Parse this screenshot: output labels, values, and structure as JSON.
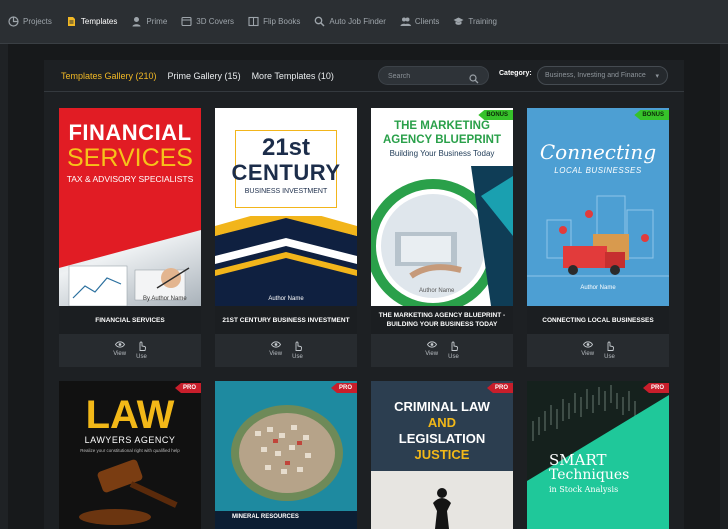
{
  "nav": {
    "items": [
      {
        "label": "Projects",
        "icon": "projects-icon",
        "active": false
      },
      {
        "label": "Templates",
        "icon": "templates-icon",
        "active": true
      },
      {
        "label": "Prime",
        "icon": "prime-icon",
        "active": false
      },
      {
        "label": "3D Covers",
        "icon": "3d-covers-icon",
        "active": false
      },
      {
        "label": "Flip Books",
        "icon": "flip-books-icon",
        "active": false
      },
      {
        "label": "Auto Job Finder",
        "icon": "search-icon",
        "active": false
      },
      {
        "label": "Clients",
        "icon": "clients-icon",
        "active": false
      },
      {
        "label": "Training",
        "icon": "training-icon",
        "active": false
      }
    ]
  },
  "gallery": {
    "tabs": [
      {
        "label": "Templates Gallery (210)",
        "active": true
      },
      {
        "label": "Prime Gallery (15)",
        "active": false
      },
      {
        "label": "More Templates (10)",
        "active": false
      }
    ],
    "search_placeholder": "Search",
    "category_label": "Category:",
    "category_value": "Business, Investing and Finance",
    "view_label": "View",
    "use_label": "Use"
  },
  "colors": {
    "accent": "#f1b825",
    "bonus": "#36c22a",
    "pro": "#c81e2b"
  },
  "cards": [
    {
      "title": "FINANCIAL SERVICES",
      "badge": "",
      "cover": {
        "line1": "FINANCIAL",
        "line2": "SERVICES",
        "line3": "TAX & ADVISORY SPECIALISTS",
        "author": "By Author Name"
      }
    },
    {
      "title": "21ST CENTURY BUSINESS INVESTMENT",
      "badge": "",
      "cover": {
        "line1": "21st",
        "line2": "CENTURY",
        "line3": "BUSINESS INVESTMENT",
        "author": "Author Name"
      }
    },
    {
      "title": "THE MARKETING AGENCY BLUEPRINT - BUILDING YOUR BUSINESS TODAY",
      "badge": "BONUS",
      "cover": {
        "line1": "THE MARKETING",
        "line2": "AGENCY BLUEPRINT",
        "line3": "Building Your Business Today",
        "author": "Author Name"
      }
    },
    {
      "title": "CONNECTING LOCAL BUSINESSES",
      "badge": "BONUS",
      "cover": {
        "line1": "Connecting",
        "line2": "LOCAL BUSINESSES",
        "author": "Author Name"
      }
    },
    {
      "badge": "PRO",
      "cover": {
        "line1": "LAW",
        "line2": "LAWYERS AGENCY",
        "line3": "Realize your constitutional right with qualified help"
      }
    },
    {
      "badge": "PRO",
      "cover": {
        "line1": "MINERAL RESOURCES"
      }
    },
    {
      "badge": "PRO",
      "cover": {
        "line1": "CRIMINAL LAW",
        "line2": "AND",
        "line3": "LEGISLATION",
        "line4": "JUSTICE"
      }
    },
    {
      "badge": "PRO",
      "cover": {
        "line1": "SMART",
        "line2": "Techniques",
        "line3": "in Stock Analysis"
      }
    }
  ]
}
